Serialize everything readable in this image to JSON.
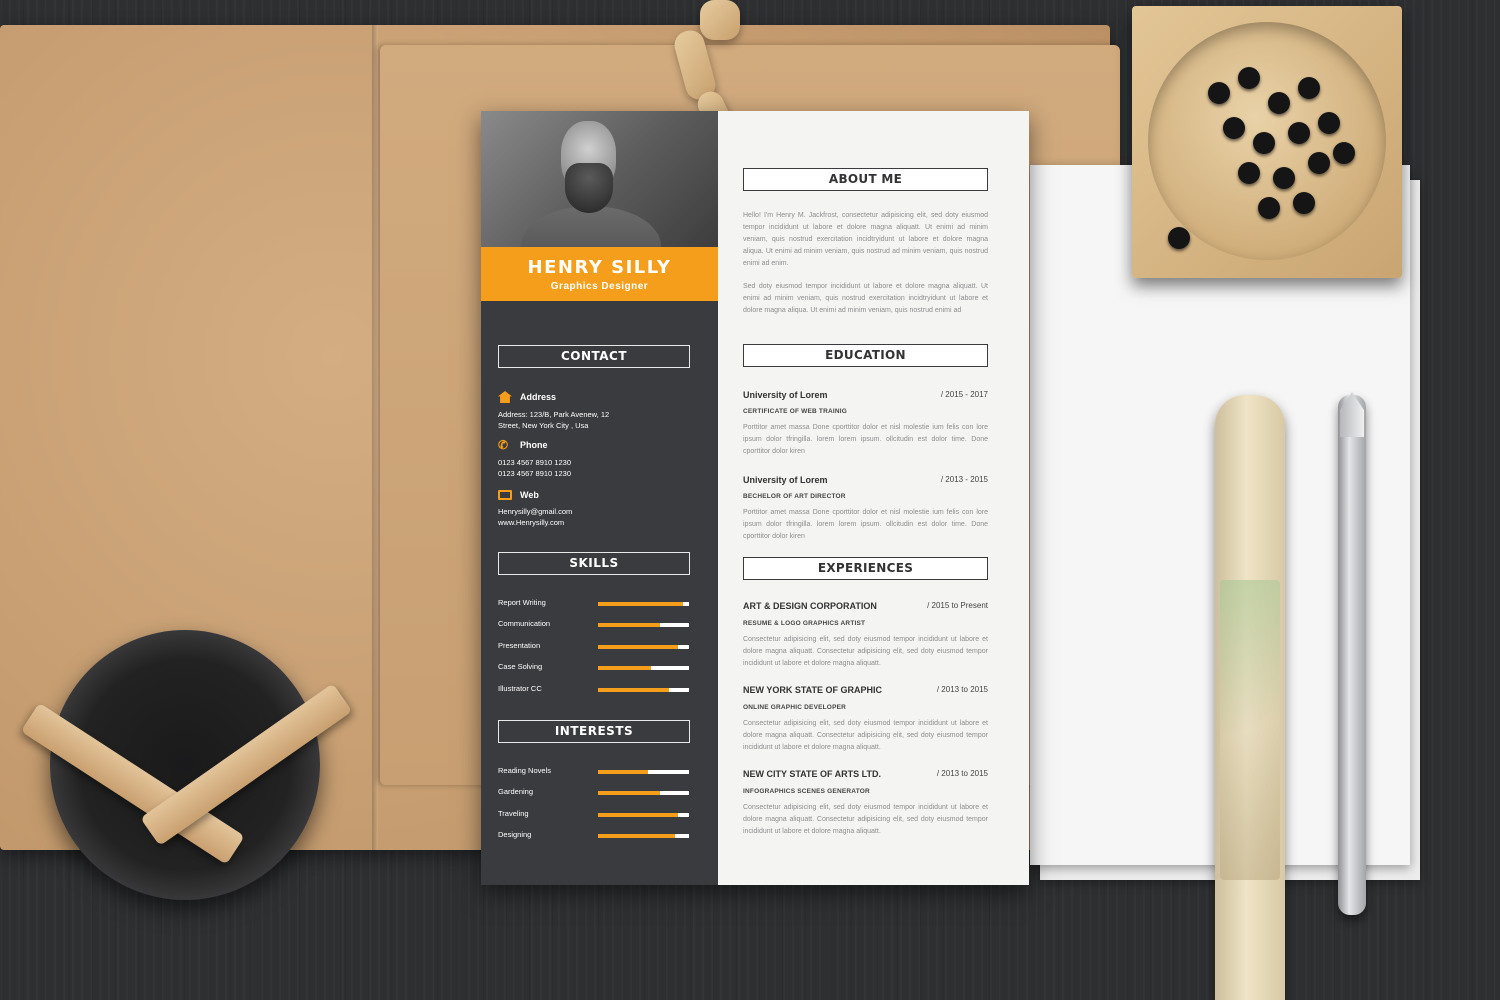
{
  "profile": {
    "name": "HENRY SILLY",
    "title": "Graphics Designer"
  },
  "colors": {
    "accent": "#f59e1b",
    "sidebar": "#3a3b3e",
    "page": "#f4f4f3"
  },
  "contact": {
    "heading": "CONTACT",
    "address": {
      "label": "Address",
      "lines": [
        "Address: 123/B, Park Avenew, 12",
        "Street, New York City , Usa"
      ],
      "icon": "home-icon"
    },
    "phone": {
      "label": "Phone",
      "lines": [
        "0123 4567 8910 1230",
        "0123 4567 8910 1230"
      ],
      "icon": "phone-icon"
    },
    "web": {
      "label": "Web",
      "lines": [
        "Henrysilly@gmail.com",
        "www.Henrysilly.com"
      ],
      "icon": "monitor-icon"
    }
  },
  "skills": {
    "heading": "SKILLS",
    "items": [
      {
        "label": "Report Writing",
        "level": 0.93
      },
      {
        "label": "Communication",
        "level": 0.68
      },
      {
        "label": "Presentation",
        "level": 0.88
      },
      {
        "label": "Case Solving",
        "level": 0.58
      },
      {
        "label": "Illustrator CC",
        "level": 0.78
      }
    ]
  },
  "interests": {
    "heading": "INTERESTS",
    "items": [
      {
        "label": "Reading Novels",
        "level": 0.55
      },
      {
        "label": "Gardening",
        "level": 0.68
      },
      {
        "label": "Traveling",
        "level": 0.88
      },
      {
        "label": "Designing",
        "level": 0.85
      }
    ]
  },
  "about": {
    "heading": "ABOUT ME",
    "paragraphs": [
      "Hello! I'm Henry M. Jackfrost, consectetur adipisicing elit, sed doty eiusmod tempor incididunt ut labore et dolore magna aliquatt. Ut enimi ad minim veniam, quis nostrud exercitation incidtryidunt ut labore et dolore magna aliqua. Ut enimi ad minim veniam, quis nostrud ad minim veniam, quis nostrud enimi ad enim.",
      "Sed doty eiusmod tempor incididunt ut labore et dolore magna aliquatt. Ut enimi ad minim veniam, quis nostrud exercitation incidtryidunt ut labore et dolore magna aliqua. Ut enimi ad minim veniam, quis nostrud enimi ad"
    ]
  },
  "education": {
    "heading": "EDUCATION",
    "entries": [
      {
        "school": "University of Lorem",
        "date": "/ 2015 - 2017",
        "degree": "CERTIFICATE OF WEB TRAINIG",
        "text": "Porttitor amet massa Done cporttitor dolor et nisl molestie ium felis con lore ipsum dolor tfringilla. lorem lorem ipsum. ollcitudin est dolor time. Done cporttitor dolor kiren"
      },
      {
        "school": "University of Lorem",
        "date": "/ 2013 - 2015",
        "degree": "BECHELOR OF ART DIRECTOR",
        "text": "Porttitor amet massa Done cporttitor dolor et nisl molestie ium felis con lore ipsum dolor tfringilla. lorem lorem ipsum. ollcitudin est dolor time. Done cporttitor dolor kiren"
      }
    ]
  },
  "experiences": {
    "heading": "EXPERIENCES",
    "entries": [
      {
        "company": "ART & DESIGN CORPORATION",
        "date": "/ 2015 to Present",
        "role": "RESUME & LOGO GRAPHICS ARTIST",
        "text": "Consectetur adipisicing elit, sed doty eiusmod tempor incididunt ut labore et dolore magna aliquatt. Consectetur adipisicing elit, sed doty eiusmod tempor incididunt ut labore et dolore magna aliquatt."
      },
      {
        "company": "NEW YORK STATE OF GRAPHIC",
        "date": "/ 2013 to 2015",
        "role": "ONLINE GRAPHIC DEVELOPER",
        "text": "Consectetur adipisicing elit, sed doty eiusmod tempor incididunt ut labore et dolore magna aliquatt. Consectetur adipisicing elit, sed doty eiusmod tempor incididunt ut labore et dolore magna aliquatt."
      },
      {
        "company": "NEW CITY STATE OF ARTS LTD.",
        "date": "/ 2013 to 2015",
        "role": "INFOGRAPHICS SCENES GENERATOR",
        "text": "Consectetur adipisicing elit, sed doty eiusmod tempor incididunt ut labore et dolore magna aliquatt. Consectetur adipisicing elit, sed doty eiusmod tempor incididunt ut labore et dolore magna aliquatt."
      }
    ]
  }
}
